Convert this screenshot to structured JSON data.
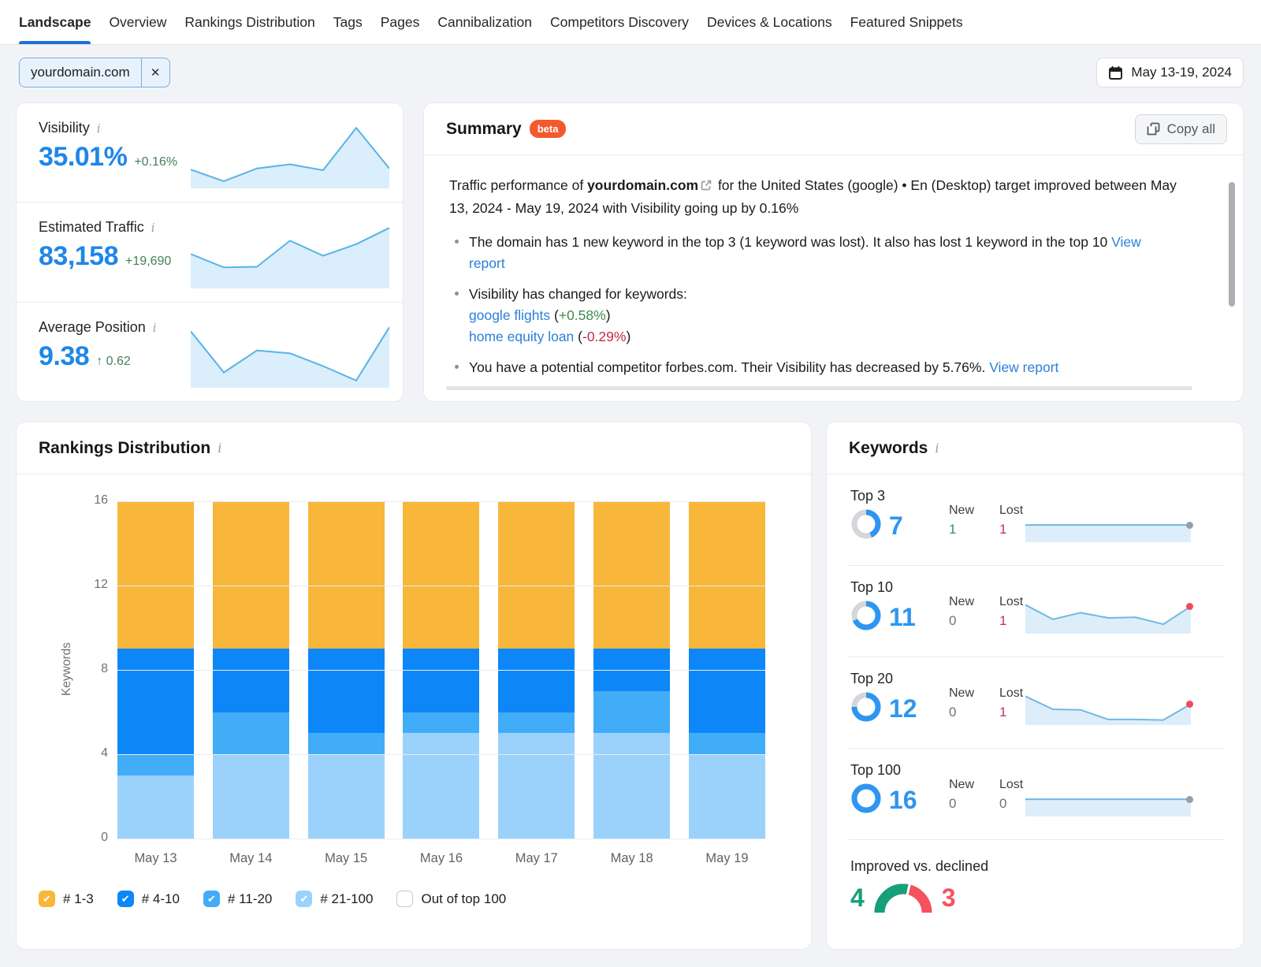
{
  "nav": {
    "tabs": [
      {
        "label": "Landscape",
        "active": true
      },
      {
        "label": "Overview",
        "active": false
      },
      {
        "label": "Rankings Distribution",
        "active": false
      },
      {
        "label": "Tags",
        "active": false
      },
      {
        "label": "Pages",
        "active": false
      },
      {
        "label": "Cannibalization",
        "active": false
      },
      {
        "label": "Competitors Discovery",
        "active": false
      },
      {
        "label": "Devices & Locations",
        "active": false
      },
      {
        "label": "Featured Snippets",
        "active": false
      }
    ],
    "active_color": "#1d6fdb"
  },
  "filters": {
    "domain_chip": {
      "label": "yourdomain.com",
      "close_icon": "✕"
    },
    "date_button": {
      "label": "May 13-19, 2024"
    }
  },
  "metrics": [
    {
      "label": "Visibility",
      "value": "35.01%",
      "change": "+0.16%",
      "spark_id": "visibility-spark"
    },
    {
      "label": "Estimated Traffic",
      "value": "83,158",
      "change": "+19,690",
      "spark_id": "traffic-spark"
    },
    {
      "label": "Average Position",
      "value": "9.38",
      "change": "↑ 0.62",
      "spark_id": "position-spark"
    }
  ],
  "summary": {
    "title": "Summary",
    "badge": "beta",
    "copy_button_label": "Copy all",
    "intro": [
      {
        "t": "Traffic performance of "
      },
      {
        "t": "yourdomain.com",
        "s": "bold"
      },
      {
        "icon": "external-link-icon"
      },
      {
        "t": " for the United States (google) • En (Desktop) target improved between May 13, 2024 - May 19, 2024 with Visibility going up by 0.16%"
      }
    ],
    "bullets": [
      [
        {
          "t": "The domain has 1 new keyword in the top 3 (1 keyword was lost). It also has lost 1 keyword in the top 10 "
        },
        {
          "t": "View report",
          "s": "link"
        }
      ],
      [
        {
          "t": "Visibility has changed for keywords:"
        },
        {
          "br": true
        },
        {
          "t": "google flights",
          "s": "link"
        },
        {
          "t": " ("
        },
        {
          "t": "+0.58%",
          "s": "green"
        },
        {
          "t": ")"
        },
        {
          "br": true
        },
        {
          "t": "home equity loan",
          "s": "link"
        },
        {
          "t": " ("
        },
        {
          "t": "-0.29%",
          "s": "red"
        },
        {
          "t": ")"
        }
      ],
      [
        {
          "t": "You have a potential competitor forbes.com. Their Visibility has decreased by 5.76%. "
        },
        {
          "t": "View report",
          "s": "link"
        }
      ]
    ]
  },
  "rankings": {
    "title": "Rankings Distribution"
  },
  "keywords": {
    "title": "Keywords",
    "new_header": "New",
    "lost_header": "Lost",
    "rows": [
      {
        "label": "Top 3",
        "value": 7,
        "new": 1,
        "lost": 1,
        "donut_fraction": 0.4375,
        "spark_id": "top3-spark"
      },
      {
        "label": "Top 10",
        "value": 11,
        "new": 0,
        "lost": 1,
        "donut_fraction": 0.6875,
        "spark_id": "top10-spark"
      },
      {
        "label": "Top 20",
        "value": 12,
        "new": 0,
        "lost": 1,
        "donut_fraction": 0.75,
        "spark_id": "top20-spark"
      },
      {
        "label": "Top 100",
        "value": 16,
        "new": 0,
        "lost": 0,
        "donut_fraction": 1,
        "spark_id": "top100-spark"
      }
    ],
    "improved_declined": {
      "label": "Improved vs. declined",
      "improved": 4,
      "declined": 3,
      "improved_color": "#14a07a",
      "declined_color": "#f4525f"
    }
  },
  "chart_data": [
    {
      "id": "rankings-distribution",
      "type": "bar",
      "stacked": true,
      "title": "Rankings Distribution",
      "categories": [
        "May 13",
        "May 14",
        "May 15",
        "May 16",
        "May 17",
        "May 18",
        "May 19"
      ],
      "series": [
        {
          "name": "# 1-3",
          "color": "#f8b63b",
          "values": [
            7,
            7,
            7,
            7,
            7,
            7,
            7
          ]
        },
        {
          "name": "# 4-10",
          "color": "#0d87f8",
          "values": [
            5,
            3,
            4,
            3,
            3,
            2,
            4
          ]
        },
        {
          "name": "# 11-20",
          "color": "#41acf8",
          "values": [
            1,
            2,
            1,
            1,
            1,
            2,
            1
          ]
        },
        {
          "name": "# 21-100",
          "color": "#9bd2fb",
          "values": [
            3,
            4,
            4,
            5,
            5,
            5,
            4
          ]
        }
      ],
      "stack_order": "first-series-on-top",
      "xlabel": "",
      "ylabel": "Keywords",
      "ylim": [
        0,
        16
      ],
      "yticks": [
        0,
        4,
        8,
        12,
        16
      ],
      "grid": true,
      "legend_position": "bottom",
      "legend": [
        {
          "label": "# 1-3",
          "color": "#f8b63b",
          "checked": true
        },
        {
          "label": "# 4-10",
          "color": "#0d87f8",
          "checked": true
        },
        {
          "label": "# 11-20",
          "color": "#41acf8",
          "checked": true
        },
        {
          "label": "# 21-100",
          "color": "#9bd2fb",
          "checked": true
        },
        {
          "label": "Out of top 100",
          "color": "#ffffff",
          "checked": false
        }
      ]
    },
    {
      "id": "visibility-spark",
      "type": "area",
      "points_norm": [
        0.28,
        0.08,
        0.3,
        0.37,
        0.27,
        1.0,
        0.3
      ],
      "line_color": "#58b4e4",
      "fill_color": "#daeefb"
    },
    {
      "id": "traffic-spark",
      "type": "area",
      "points_norm": [
        0.55,
        0.32,
        0.33,
        0.78,
        0.52,
        0.72,
        1.0
      ],
      "line_color": "#58b4e4",
      "fill_color": "#daeefb"
    },
    {
      "id": "position-spark",
      "type": "area",
      "points_norm": [
        0.93,
        0.22,
        0.6,
        0.55,
        0.33,
        0.08,
        1.0
      ],
      "line_color": "#58b4e4",
      "fill_color": "#daeefb"
    },
    {
      "id": "top3-spark",
      "type": "area",
      "points_norm": [
        0.55,
        0.55,
        0.55,
        0.55,
        0.55,
        0.55,
        0.55
      ],
      "line_color": "#6fb9e2",
      "fill_color": "#ddeefa",
      "end_dot_color": "#9a9da3"
    },
    {
      "id": "top10-spark",
      "type": "area",
      "points_norm": [
        0.95,
        0.45,
        0.68,
        0.5,
        0.52,
        0.28,
        0.9
      ],
      "line_color": "#6fb9e2",
      "fill_color": "#ddeefa",
      "end_dot_color": "#f4485a"
    },
    {
      "id": "top20-spark",
      "type": "area",
      "points_norm": [
        0.95,
        0.5,
        0.48,
        0.15,
        0.15,
        0.13,
        0.68
      ],
      "line_color": "#6fb9e2",
      "fill_color": "#ddeefa",
      "end_dot_color": "#f4485a"
    },
    {
      "id": "top100-spark",
      "type": "area",
      "points_norm": [
        0.55,
        0.55,
        0.55,
        0.55,
        0.55,
        0.55,
        0.55
      ],
      "line_color": "#6fb9e2",
      "fill_color": "#ddeefa",
      "end_dot_color": "#9a9da3"
    }
  ]
}
